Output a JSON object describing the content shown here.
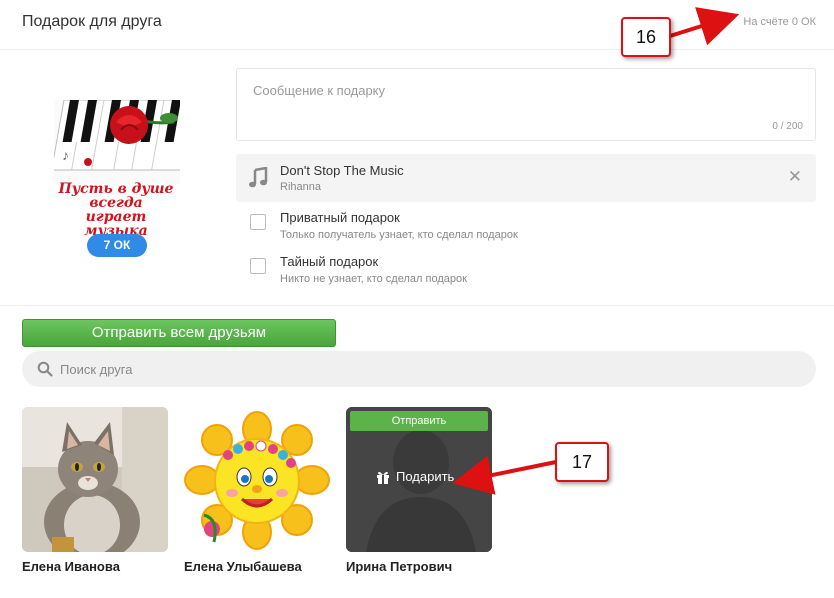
{
  "header": {
    "title": "Подарок для друга",
    "balance": "На счёте 0 ОК"
  },
  "gift": {
    "caption_lines": [
      "Пусть в душе",
      "всегда",
      "играет музыка"
    ],
    "price": "7 ОК"
  },
  "message": {
    "placeholder": "Сообщение к подарку",
    "counter": "0 / 200"
  },
  "music": {
    "song": "Don't Stop The Music",
    "artist": "Rihanna",
    "icon": "music-note-icon"
  },
  "options": [
    {
      "label": "Приватный подарок",
      "description": "Только получатель узнает, кто сделал подарок",
      "checked": false
    },
    {
      "label": "Тайный подарок",
      "description": "Никто не узнает, кто сделал подарок",
      "checked": false
    }
  ],
  "send_all_label": "Отправить всем друзьям",
  "search": {
    "placeholder": "Поиск друга",
    "value": ""
  },
  "friends": [
    {
      "name": "Елена Иванова"
    },
    {
      "name": "Елена Улыбашева"
    },
    {
      "name": "Ирина Петрович",
      "hover_send_label": "Отправить",
      "hover_gift_label": "Подарить"
    }
  ],
  "annotations": [
    {
      "number": "16"
    },
    {
      "number": "17"
    }
  ],
  "colors": {
    "accent_green": "#5bb34a",
    "price_blue": "#2f8be6",
    "annotation_red": "#dd1111"
  }
}
